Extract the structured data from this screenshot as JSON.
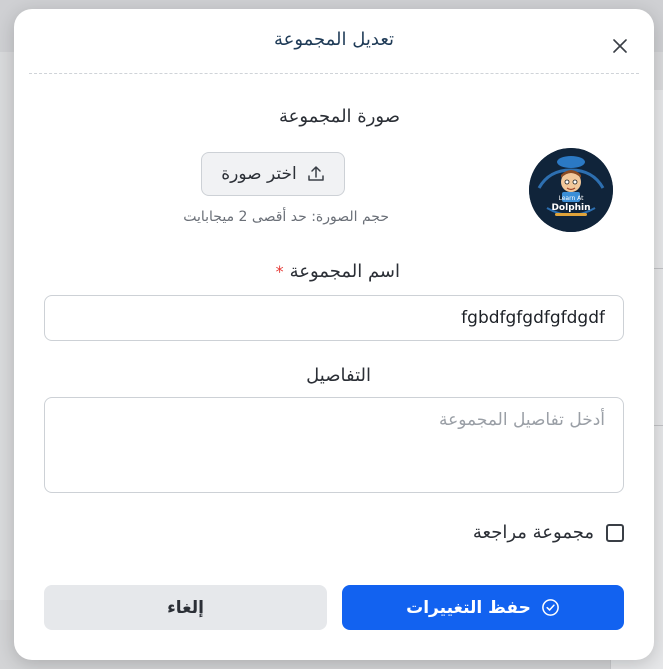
{
  "modal": {
    "title": "تعديل المجموعة",
    "close_icon": "close-icon"
  },
  "photo": {
    "label": "صورة المجموعة",
    "choose_button": "اختر صورة",
    "upload_icon": "upload-icon",
    "size_hint": "حجم الصورة: حد أقصى 2 ميجابايت",
    "avatar_logo_text": [
      "Learn At",
      "Dolphin"
    ]
  },
  "name": {
    "label": "اسم المجموعة",
    "required_marker": "*",
    "value": "fgbdfgfgdfgfdgdf"
  },
  "details": {
    "label": "التفاصيل",
    "placeholder": "أدخل تفاصيل المجموعة"
  },
  "review": {
    "label": "مجموعة مراجعة",
    "checked": false
  },
  "actions": {
    "save_label": "حفظ التغييرات",
    "save_icon": "check-circle-icon",
    "cancel_label": "إلغاء"
  },
  "colors": {
    "primary": "#1262f0",
    "title": "#1f3b57",
    "required": "#e53935"
  }
}
